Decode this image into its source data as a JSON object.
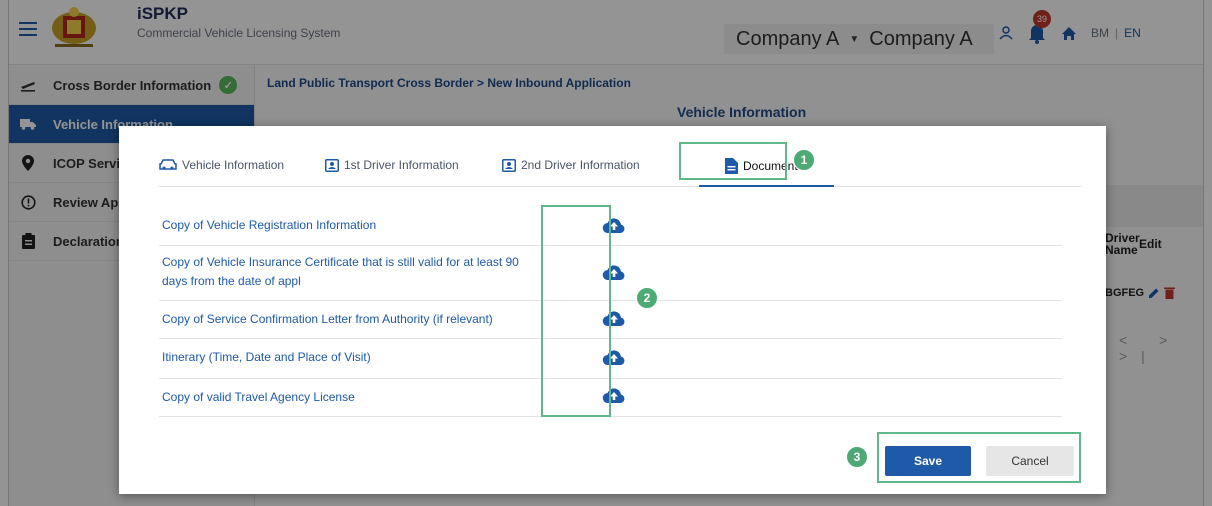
{
  "header": {
    "app_name": "iSPKP",
    "app_subtitle": "Commercial Vehicle Licensing System",
    "company_selected": "Company A",
    "company_name": "Company A",
    "notification_count": "39",
    "lang_bm": "BM",
    "lang_sep": "|",
    "lang_en": "EN"
  },
  "sidebar": {
    "items": [
      {
        "label": "Cross Border Information",
        "icon": "plane-departure-icon"
      },
      {
        "label": "Vehicle Information",
        "icon": "truck-icon"
      },
      {
        "label": "ICOP Service",
        "icon": "map-pin-icon"
      },
      {
        "label": "Review Application",
        "icon": "alert-circle-icon"
      },
      {
        "label": "Declaration",
        "icon": "clipboard-icon"
      }
    ]
  },
  "main": {
    "breadcrumb": "Land Public Transport Cross Border > New Inbound Application",
    "title": "Vehicle Information",
    "table_header_driver": "Driver Name",
    "table_header_edit": "Edit",
    "row_driver": "BGFEG",
    "pager": "< > >|"
  },
  "modal": {
    "tabs": [
      {
        "label": "Vehicle Information"
      },
      {
        "label": "1st Driver Information"
      },
      {
        "label": "2nd Driver Information"
      },
      {
        "label": "Documents"
      }
    ],
    "documents": [
      {
        "label": "Copy of Vehicle Registration Information"
      },
      {
        "label": "Copy of Vehicle Insurance Certificate that is still valid for at least 90 days from the date of appl"
      },
      {
        "label": "Copy of Service Confirmation Letter from Authority (if relevant)"
      },
      {
        "label": "Itinerary (Time, Date and Place of Visit)"
      },
      {
        "label": "Copy of valid Travel Agency License"
      }
    ],
    "save_label": "Save",
    "cancel_label": "Cancel"
  },
  "annotations": {
    "step1": "1",
    "step2": "2",
    "step3": "3"
  },
  "colors": {
    "primary": "#1e5aa8",
    "annotation_green": "#4eaa74",
    "success": "#5cb85c"
  }
}
